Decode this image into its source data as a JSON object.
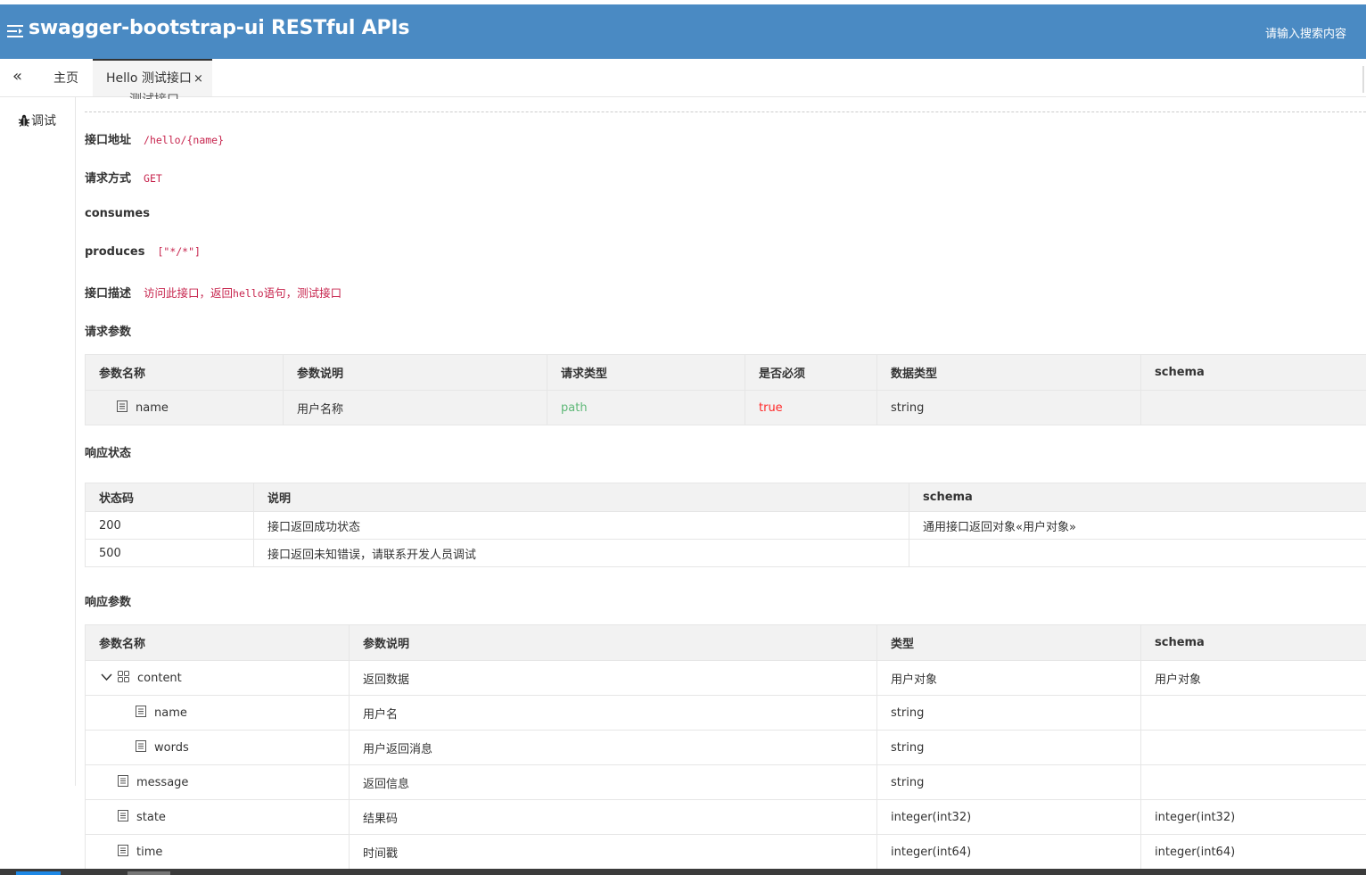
{
  "header": {
    "title": "swagger-bootstrap-ui RESTful APIs",
    "search_placeholder": "请输入搜索内容",
    "bg_color": "#4a8ac3"
  },
  "tabs": {
    "collapse_icon": "double-chevron-left-icon",
    "home_label": "主页",
    "active_label": "Hello 测试接口",
    "close_glyph": "×"
  },
  "sidebar": {
    "debug_label": "调试"
  },
  "api": {
    "cut_title": "测试接口",
    "address_label": "接口地址",
    "address_value": "/hello/{name}",
    "method_label": "请求方式",
    "method_value": "GET",
    "consumes_label": "consumes",
    "produces_label": "produces",
    "produces_value": "[\"*/*\"]",
    "desc_label": "接口描述",
    "desc_value_pre": "访问此接口，返回",
    "desc_value_mono": "hello",
    "desc_value_post": "语句，测试接口"
  },
  "request_params": {
    "title": "请求参数",
    "headers": [
      "参数名称",
      "参数说明",
      "请求类型",
      "是否必须",
      "数据类型",
      "schema"
    ],
    "rows": [
      {
        "name": "name",
        "desc": "用户名称",
        "in": "path",
        "required": "true",
        "type": "string",
        "schema": ""
      }
    ]
  },
  "response_status": {
    "title": "响应状态",
    "headers": [
      "状态码",
      "说明",
      "schema"
    ],
    "rows": [
      {
        "code": "200",
        "desc": "接口返回成功状态",
        "schema": "通用接口返回对象«用户对象»"
      },
      {
        "code": "500",
        "desc": "接口返回未知错误，请联系开发人员调试",
        "schema": ""
      }
    ]
  },
  "response_params": {
    "title": "响应参数",
    "headers": [
      "参数名称",
      "参数说明",
      "类型",
      "schema"
    ],
    "rows": [
      {
        "name": "content",
        "desc": "返回数据",
        "type": "用户对象",
        "schema": "用户对象"
      },
      {
        "name": "name",
        "desc": "用户名",
        "type": "string",
        "schema": ""
      },
      {
        "name": "words",
        "desc": "用户返回消息",
        "type": "string",
        "schema": ""
      },
      {
        "name": "message",
        "desc": "返回信息",
        "type": "string",
        "schema": ""
      },
      {
        "name": "state",
        "desc": "结果码",
        "type": "integer(int32)",
        "schema": "integer(int32)"
      },
      {
        "name": "time",
        "desc": "时间戳",
        "type": "integer(int64)",
        "schema": "integer(int64)"
      }
    ]
  }
}
